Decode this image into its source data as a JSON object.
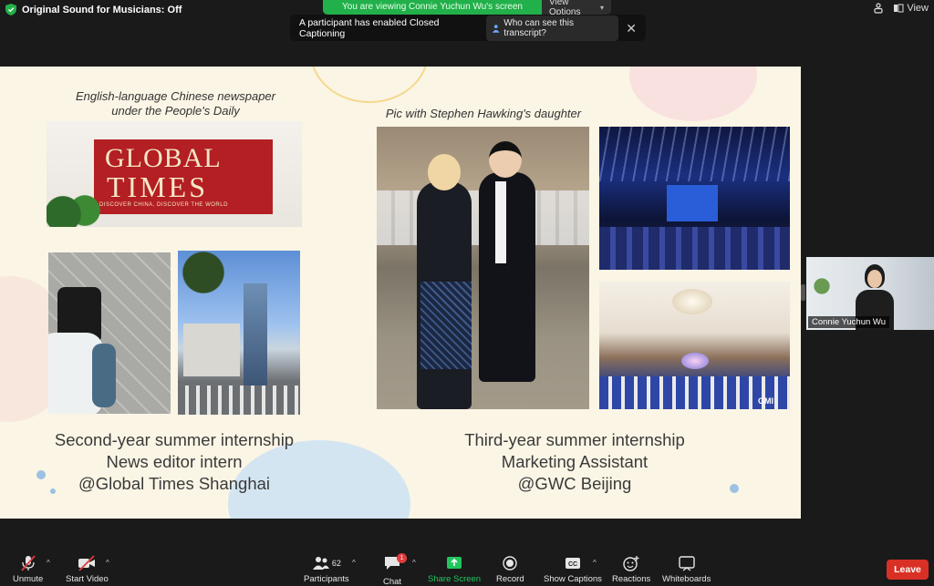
{
  "top": {
    "sound_status": "Original Sound for Musicians: Off",
    "viewing_banner": "You are viewing Connie Yuchun Wu's screen",
    "view_options": "View Options",
    "view_label": "View"
  },
  "cc_notice": {
    "message": "A participant has enabled Closed Captioning",
    "who_button": "Who can see this transcript?"
  },
  "slide": {
    "caption_left": "English-language Chinese newspaper\nunder the People's Daily",
    "caption_middle": "Pic with Stephen Hawking's daughter",
    "logo_global": "GLOBAL",
    "logo_times": "TIMES",
    "logo_tagline": "DISCOVER CHINA, DISCOVER THE WORLD",
    "left_block": [
      "Second-year summer internship",
      "News editor intern",
      "@Global Times Shanghai"
    ],
    "right_block": [
      "Third-year summer internship",
      "Marketing Assistant",
      "@GWC Beijing"
    ],
    "gmi_mark": "GMI"
  },
  "participant": {
    "name": "Connie Yuchun Wu"
  },
  "toolbar": {
    "unmute": "Unmute",
    "start_video": "Start Video",
    "participants": "Participants",
    "participants_count": "62",
    "chat": "Chat",
    "chat_badge": "1",
    "share_screen": "Share Screen",
    "record": "Record",
    "show_captions": "Show Captions",
    "reactions": "Reactions",
    "whiteboards": "Whiteboards",
    "leave": "Leave"
  },
  "colors": {
    "slide_bg": "#fbf5e5",
    "share_green": "#22c55e",
    "leave_red": "#d93025",
    "banner_green": "#22b04b"
  }
}
